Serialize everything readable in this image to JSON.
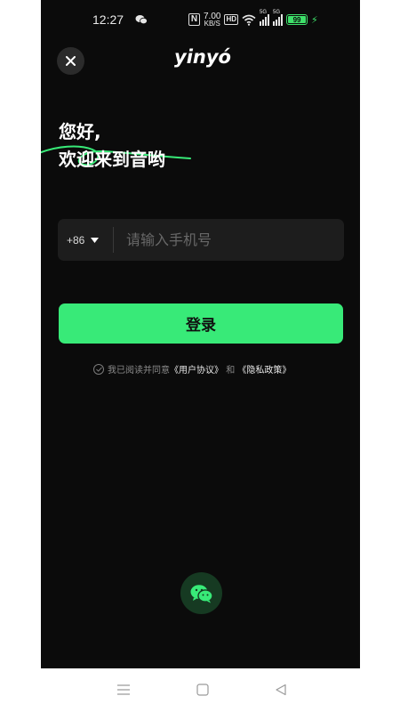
{
  "status_bar": {
    "time": "12:27",
    "net_speed_value": "7.00",
    "net_speed_unit": "KB/S",
    "hd_label": "HD",
    "sim1_tag": "5G",
    "sim2_tag": "5G",
    "battery_level": "99"
  },
  "header": {
    "logo_text": "yinyó"
  },
  "greeting": {
    "line1": "您好,",
    "line2": "欢迎来到音哟"
  },
  "phone_field": {
    "country_code": "+86",
    "placeholder": "请输入手机号",
    "value": ""
  },
  "login_button": {
    "label": "登录"
  },
  "agreement": {
    "prefix": "我已阅读并同意",
    "user_agreement": "《用户协议》",
    "and": "和",
    "privacy_policy": "《隐私政策》"
  },
  "colors": {
    "background": "#0b0b0b",
    "accent": "#38ea78",
    "input_bg": "#1d1d1d"
  },
  "icons": {
    "close": "close-icon",
    "dropdown": "caret-down-icon",
    "wechat": "wechat-icon"
  }
}
